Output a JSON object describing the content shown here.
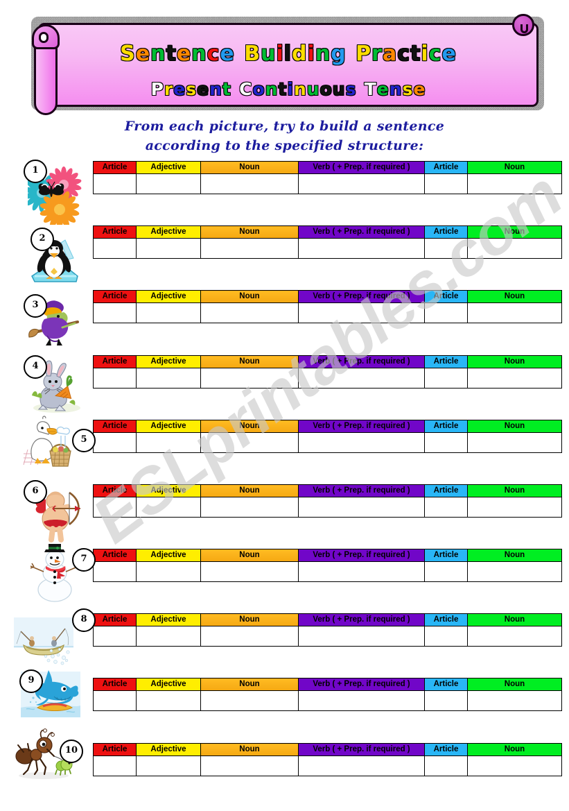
{
  "banner": {
    "title_main": "Sentence Building Practice",
    "title_sub": "Present Continuous Tense",
    "title_main_letters": [
      {
        "ch": "S",
        "color": "#ffdd00"
      },
      {
        "ch": "e",
        "color": "#ff8800"
      },
      {
        "ch": "n",
        "color": "#00bb33"
      },
      {
        "ch": "t",
        "color": "#111111"
      },
      {
        "ch": "e",
        "color": "#ff8800"
      },
      {
        "ch": "n",
        "color": "#00bb33"
      },
      {
        "ch": "c",
        "color": "#ee1111"
      },
      {
        "ch": "e",
        "color": "#2299ee"
      },
      {
        "ch": " ",
        "color": "none"
      },
      {
        "ch": "B",
        "color": "#ffdd00"
      },
      {
        "ch": "u",
        "color": "#00bb33"
      },
      {
        "ch": "i",
        "color": "#ee1111"
      },
      {
        "ch": "l",
        "color": "#111111"
      },
      {
        "ch": "d",
        "color": "#ffdd00"
      },
      {
        "ch": "i",
        "color": "#ee1111"
      },
      {
        "ch": "n",
        "color": "#00bb33"
      },
      {
        "ch": "g",
        "color": "#2299ee"
      },
      {
        "ch": " ",
        "color": "none"
      },
      {
        "ch": "P",
        "color": "#ffdd00"
      },
      {
        "ch": "r",
        "color": "#00bb33"
      },
      {
        "ch": "a",
        "color": "#ff8800"
      },
      {
        "ch": "c",
        "color": "#111111"
      },
      {
        "ch": "t",
        "color": "#111111"
      },
      {
        "ch": "i",
        "color": "#ffdd00"
      },
      {
        "ch": "c",
        "color": "#00bb33"
      },
      {
        "ch": "e",
        "color": "#2299ee"
      }
    ],
    "title_sub_letters": [
      {
        "ch": "P",
        "color": "#ffffff"
      },
      {
        "ch": "r",
        "color": "#ffdd00"
      },
      {
        "ch": "e",
        "color": "#2222cc"
      },
      {
        "ch": "s",
        "color": "#ffdd00"
      },
      {
        "ch": "e",
        "color": "#111111"
      },
      {
        "ch": "n",
        "color": "#2222cc"
      },
      {
        "ch": "t",
        "color": "#00bb33"
      },
      {
        "ch": " ",
        "color": "none"
      },
      {
        "ch": "C",
        "color": "#ffffff"
      },
      {
        "ch": "o",
        "color": "#2222cc"
      },
      {
        "ch": "n",
        "color": "#00bb33"
      },
      {
        "ch": "t",
        "color": "#111111"
      },
      {
        "ch": "i",
        "color": "#2222cc"
      },
      {
        "ch": "n",
        "color": "#ffdd00"
      },
      {
        "ch": "u",
        "color": "#00bb33"
      },
      {
        "ch": "o",
        "color": "#111111"
      },
      {
        "ch": "u",
        "color": "#111111"
      },
      {
        "ch": "s",
        "color": "#2222cc"
      },
      {
        "ch": " ",
        "color": "none"
      },
      {
        "ch": "T",
        "color": "#ffffff"
      },
      {
        "ch": "e",
        "color": "#00bb33"
      },
      {
        "ch": "n",
        "color": "#2222cc"
      },
      {
        "ch": "s",
        "color": "#ffdd00"
      },
      {
        "ch": "e",
        "color": "#ff8800"
      }
    ]
  },
  "instructions": {
    "line1": "From each picture, try to build a sentence",
    "line2": "according to the specified structure:"
  },
  "table": {
    "headers": [
      {
        "label": "Article",
        "color": "#ee1111"
      },
      {
        "label": "Adjective",
        "color": "#ffee00"
      },
      {
        "label": "Noun",
        "color": "#ffbb22"
      },
      {
        "label": "Verb  ( +  Prep. if required )",
        "color": "#7106c8"
      },
      {
        "label": "Article",
        "color": "#29b6f6"
      },
      {
        "label": "Noun",
        "color": "#00ee22"
      }
    ]
  },
  "exercises": [
    {
      "number": "1",
      "picture": "butterfly-on-flowers"
    },
    {
      "number": "2",
      "picture": "penguin-on-ice"
    },
    {
      "number": "3",
      "picture": "witch-on-broomstick"
    },
    {
      "number": "4",
      "picture": "rabbit-eating-carrot"
    },
    {
      "number": "5",
      "picture": "duck-with-picnic-basket"
    },
    {
      "number": "6",
      "picture": "cupid-shooting-bow"
    },
    {
      "number": "7",
      "picture": "snowman"
    },
    {
      "number": "8",
      "picture": "people-fishing-in-boat"
    },
    {
      "number": "9",
      "picture": "shark-surfing"
    },
    {
      "number": "10",
      "picture": "ant-walking-caterpillar"
    }
  ],
  "watermark": {
    "text": "ESLprintables.com"
  }
}
